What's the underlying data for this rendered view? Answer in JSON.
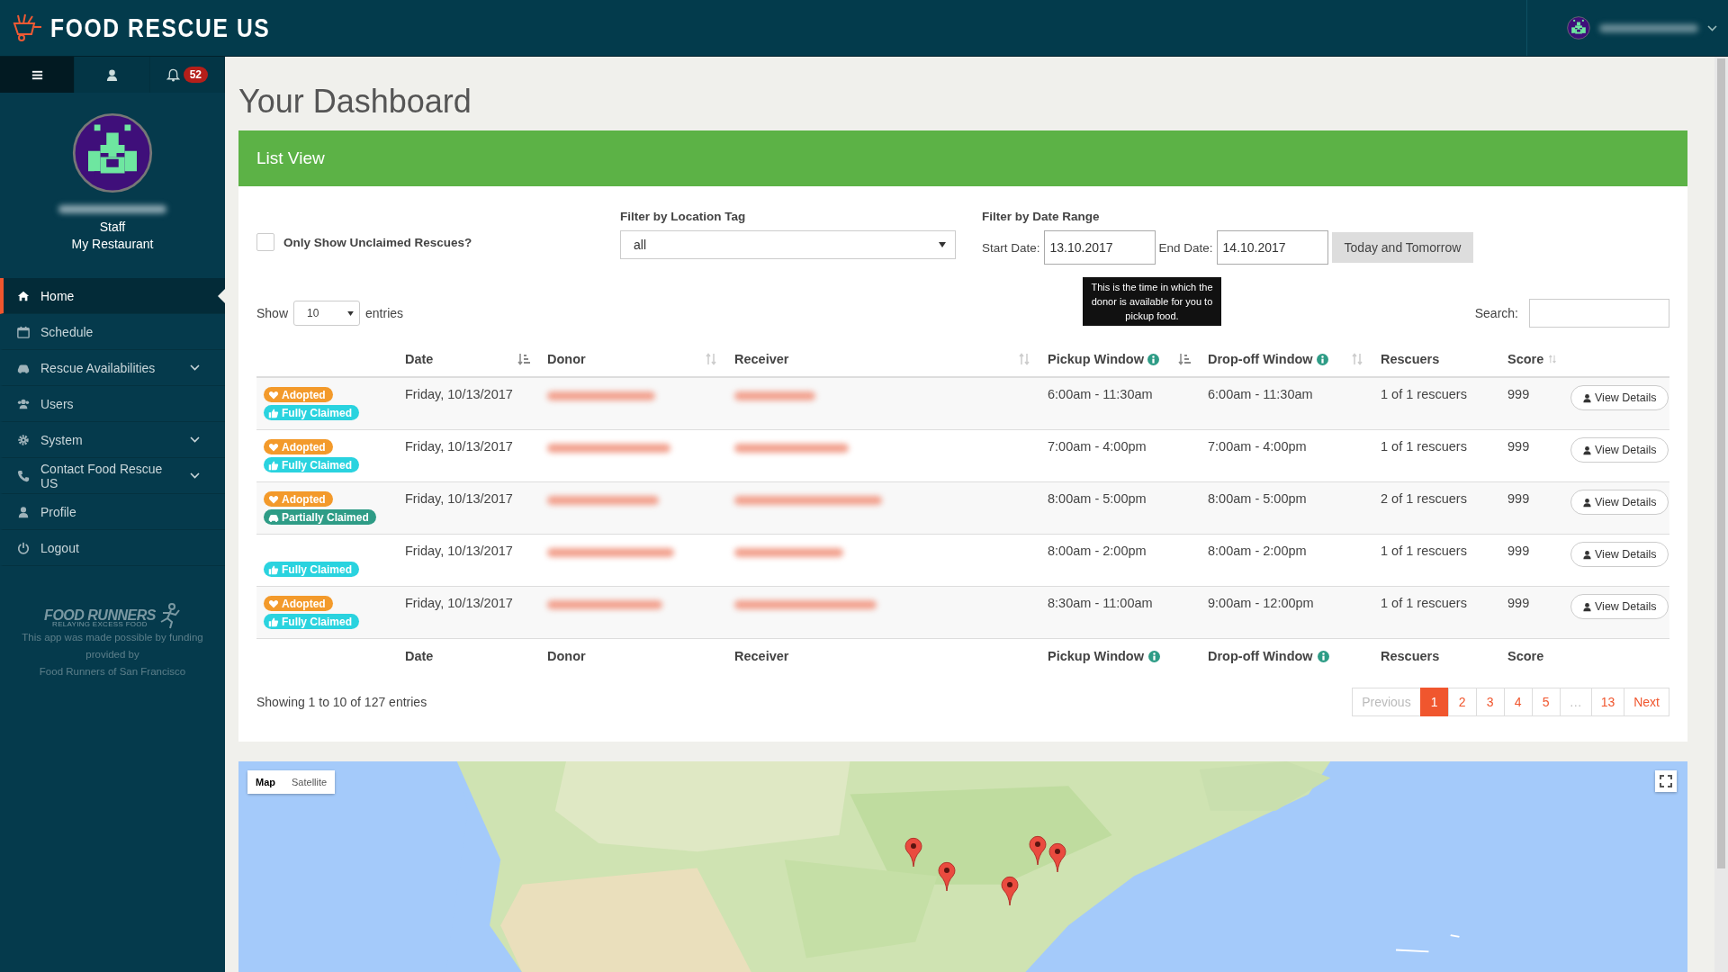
{
  "topbar": {
    "brand": "FOOD RESCUE US"
  },
  "sidebar": {
    "tabs": [
      {
        "kind": "menu",
        "selected": true
      },
      {
        "kind": "user",
        "selected": false
      },
      {
        "kind": "bell",
        "selected": false,
        "badge": "52"
      }
    ],
    "profile": {
      "role": "Staff",
      "organization": "My Restaurant"
    },
    "items": [
      {
        "label": "Home",
        "selected": true,
        "expandable": false
      },
      {
        "label": "Schedule",
        "selected": false,
        "expandable": false
      },
      {
        "label": "Rescue Availabilities",
        "selected": false,
        "expandable": true
      },
      {
        "label": "Users",
        "selected": false,
        "expandable": false
      },
      {
        "label": "System",
        "selected": false,
        "expandable": true
      },
      {
        "label": "Contact Food Rescue US",
        "selected": false,
        "expandable": true
      },
      {
        "label": "Profile",
        "selected": false,
        "expandable": false
      },
      {
        "label": "Logout",
        "selected": false,
        "expandable": false
      }
    ],
    "footer": {
      "logo_name": "FOOD RUNNERS",
      "logo_tagline": "RELAYING EXCESS FOOD",
      "note": "This app was made possible by funding provided by",
      "sponsor": "Food Runners of San Francisco"
    }
  },
  "page_title": "Your Dashboard",
  "panel": {
    "title": "List View",
    "unclaimed_filter": {
      "label": "Only Show Unclaimed Rescues?",
      "checked": false
    },
    "location_filter": {
      "label": "Filter by Location Tag",
      "value": "all"
    },
    "date_filter": {
      "label": "Filter by Date Range",
      "start_label": "Start Date:",
      "start": "13.10.2017",
      "end_label": "End Date:",
      "end": "14.10.2017",
      "button": "Today and Tomorrow"
    },
    "show": {
      "before": "Show",
      "value": "10",
      "after": "entries"
    },
    "search": {
      "label": "Search:"
    },
    "tooltip": "This is the time in which the donor is available for you to pickup food.",
    "columns": [
      {
        "label": "Date",
        "sortable": true,
        "sorted": true,
        "info": false
      },
      {
        "label": "Donor",
        "sortable": true,
        "sorted": false,
        "info": false
      },
      {
        "label": "Receiver",
        "sortable": true,
        "sorted": false,
        "info": false
      },
      {
        "label": "Pickup Window",
        "sortable": true,
        "sorted": true,
        "info": true
      },
      {
        "label": "Drop-off Window",
        "sortable": true,
        "sorted": false,
        "info": true
      },
      {
        "label": "Rescuers",
        "sortable": false,
        "info": false
      },
      {
        "label": "Score",
        "sortable": true,
        "sorted": false,
        "info": false
      }
    ],
    "footer_columns": [
      {
        "label": "Date",
        "info": false
      },
      {
        "label": "Donor",
        "info": false
      },
      {
        "label": "Receiver",
        "info": false
      },
      {
        "label": "Pickup Window",
        "info": true
      },
      {
        "label": "Drop-off Window",
        "info": true
      },
      {
        "label": "Rescuers",
        "info": false
      },
      {
        "label": "Score",
        "info": false
      }
    ],
    "rows": [
      {
        "badges": [
          {
            "kind": "adopted",
            "label": "Adopted"
          },
          {
            "kind": "fully",
            "label": "Fully Claimed"
          }
        ],
        "date": "Friday, 10/13/2017",
        "pickup": "6:00am - 11:30am",
        "dropoff": "6:00am - 11:30am",
        "rescuers": "1 of 1 rescuers",
        "score": "999",
        "action": "View Details"
      },
      {
        "badges": [
          {
            "kind": "adopted",
            "label": "Adopted"
          },
          {
            "kind": "fully",
            "label": "Fully Claimed"
          }
        ],
        "date": "Friday, 10/13/2017",
        "pickup": "7:00am - 4:00pm",
        "dropoff": "7:00am - 4:00pm",
        "rescuers": "1 of 1 rescuers",
        "score": "999",
        "action": "View Details"
      },
      {
        "badges": [
          {
            "kind": "adopted",
            "label": "Adopted"
          },
          {
            "kind": "partial",
            "label": "Partially Claimed"
          }
        ],
        "date": "Friday, 10/13/2017",
        "pickup": "8:00am - 5:00pm",
        "dropoff": "8:00am - 5:00pm",
        "rescuers": "2 of 1 rescuers",
        "score": "999",
        "action": "View Details"
      },
      {
        "badges": [
          {
            "kind": "fully",
            "label": "Fully Claimed"
          }
        ],
        "date": "Friday, 10/13/2017",
        "pickup": "8:00am - 2:00pm",
        "dropoff": "8:00am - 2:00pm",
        "rescuers": "1 of 1 rescuers",
        "score": "999",
        "action": "View Details"
      },
      {
        "badges": [
          {
            "kind": "adopted",
            "label": "Adopted"
          },
          {
            "kind": "fully",
            "label": "Fully Claimed"
          }
        ],
        "date": "Friday, 10/13/2017",
        "pickup": "8:30am - 11:00am",
        "dropoff": "9:00am - 12:00pm",
        "rescuers": "1 of 1 rescuers",
        "score": "999",
        "action": "View Details"
      }
    ],
    "summary": "Showing 1 to 10 of 127 entries",
    "pagination": [
      {
        "label": "Previous",
        "selected": false,
        "disabled": true
      },
      {
        "label": "1",
        "selected": true,
        "disabled": false
      },
      {
        "label": "2",
        "selected": false,
        "disabled": false
      },
      {
        "label": "3",
        "selected": false,
        "disabled": false
      },
      {
        "label": "4",
        "selected": false,
        "disabled": false
      },
      {
        "label": "5",
        "selected": false,
        "disabled": false
      },
      {
        "label": "…",
        "selected": false,
        "disabled": true
      },
      {
        "label": "13",
        "selected": false,
        "disabled": false
      },
      {
        "label": "Next",
        "selected": false,
        "disabled": false
      }
    ]
  },
  "map": {
    "types": [
      {
        "label": "Map",
        "selected": true
      },
      {
        "label": "Satellite",
        "selected": false
      }
    ]
  }
}
